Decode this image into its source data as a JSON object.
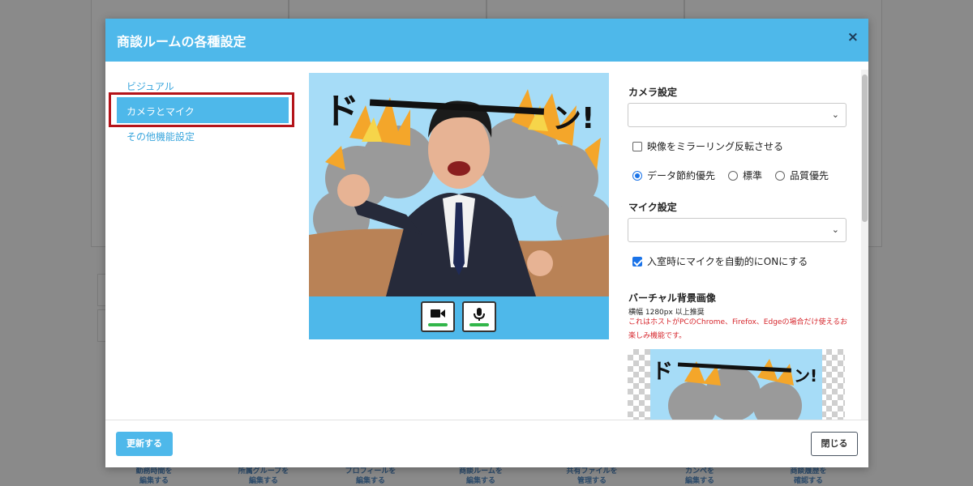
{
  "modal": {
    "title": "商談ルームの各種設定",
    "close_symbol": "×"
  },
  "nav": {
    "items": [
      {
        "label": "ビジュアル"
      },
      {
        "label": "カメラとマイク",
        "active": true
      },
      {
        "label": "その他機能設定"
      }
    ]
  },
  "preview": {
    "camera_icon": "video-camera-icon",
    "mic_icon": "microphone-icon",
    "camera_level": 1.0,
    "mic_level": 1.0,
    "effect_text": "ドーーーン!"
  },
  "settings": {
    "camera_label": "カメラ設定",
    "camera_select_value": "",
    "mirror_label": "映像をミラーリング反転させる",
    "mirror_checked": false,
    "quality_options": [
      {
        "label": "データ節約優先",
        "selected": true
      },
      {
        "label": "標準",
        "selected": false
      },
      {
        "label": "品質優先",
        "selected": false
      }
    ],
    "mic_label": "マイク設定",
    "mic_select_value": "",
    "auto_mic_label": "入室時にマイクを自動的にONにする",
    "auto_mic_checked": true,
    "vbg_label": "バーチャル背景画像",
    "vbg_size_note": "横幅 1280px 以上推奨",
    "vbg_warning": "これはホストがPCのChrome、Firefox、Edgeの場合だけ使えるお楽しみ機能です。"
  },
  "footer": {
    "update_label": "更新する",
    "close_label": "閉じる"
  },
  "background": {
    "links": [
      {
        "line1": "勤務時間を",
        "line2": "編集する"
      },
      {
        "line1": "所属グループを",
        "line2": "編集する"
      },
      {
        "line1": "プロフィールを",
        "line2": "編集する"
      },
      {
        "line1": "商談ルームを",
        "line2": "編集する"
      },
      {
        "line1": "共有ファイルを",
        "line2": "管理する"
      },
      {
        "line1": "カンペを",
        "line2": "編集する"
      },
      {
        "line1": "商談履歴を",
        "line2": "確認する"
      }
    ]
  },
  "colors": {
    "accent": "#4eb8ea",
    "highlight_border": "#b4141a",
    "warning_text": "#d6262c",
    "level_green": "#32b64a"
  }
}
